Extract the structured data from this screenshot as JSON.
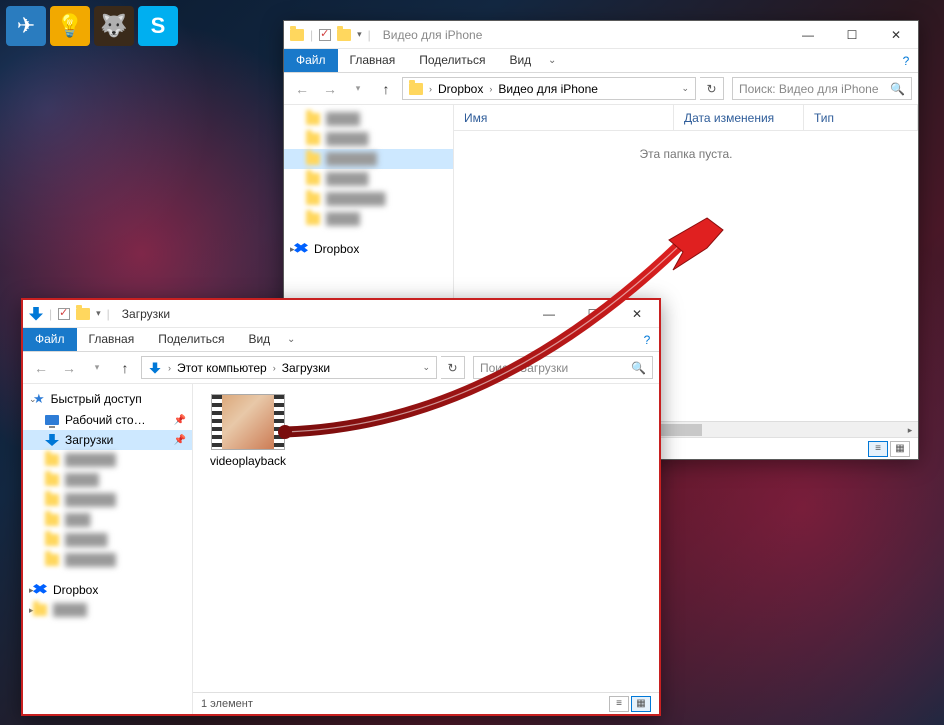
{
  "taskbar": {
    "icons": [
      "telegram",
      "bulb",
      "gimp",
      "skype"
    ],
    "skype_letter": "S"
  },
  "window_top": {
    "title": "Видео для iPhone",
    "ribbon": {
      "file": "Файл",
      "home": "Главная",
      "share": "Поделиться",
      "view": "Вид"
    },
    "breadcrumb": [
      "Dropbox",
      "Видео для iPhone"
    ],
    "search_placeholder": "Поиск: Видео для iPhone",
    "columns": {
      "name": "Имя",
      "date": "Дата изменения",
      "type": "Тип"
    },
    "empty_message": "Эта папка пуста.",
    "sidebar": {
      "dropbox_label": "Dropbox"
    }
  },
  "window_bottom": {
    "title": "Загрузки",
    "ribbon": {
      "file": "Файл",
      "home": "Главная",
      "share": "Поделиться",
      "view": "Вид"
    },
    "breadcrumb": [
      "Этот компьютер",
      "Загрузки"
    ],
    "search_placeholder": "Поиск: Загрузки",
    "sidebar": {
      "quick_access": "Быстрый доступ",
      "desktop": "Рабочий сто…",
      "downloads": "Загрузки",
      "dropbox": "Dropbox"
    },
    "file": {
      "name": "videoplayback"
    },
    "status": "1 элемент"
  }
}
